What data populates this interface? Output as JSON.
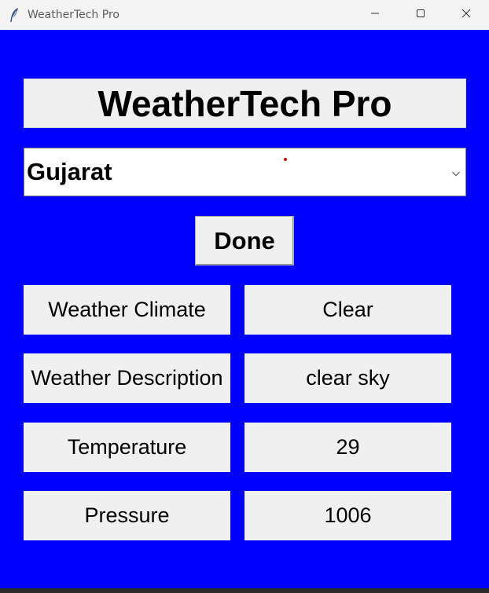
{
  "window": {
    "title": "WeatherTech Pro",
    "background_color": "#0000ff"
  },
  "titlebar_icons": {
    "app": "feather-icon",
    "minimize": "minimize-icon",
    "maximize": "maximize-icon",
    "close": "close-icon"
  },
  "header": {
    "title": "WeatherTech Pro"
  },
  "location_select": {
    "selected": "Gujarat"
  },
  "done_button": {
    "label": "Done"
  },
  "results": [
    {
      "label": "Weather Climate",
      "value": "Clear"
    },
    {
      "label": "Weather Description",
      "value": "clear sky"
    },
    {
      "label": "Temperature",
      "value": "29"
    },
    {
      "label": "Pressure",
      "value": "1006"
    }
  ]
}
